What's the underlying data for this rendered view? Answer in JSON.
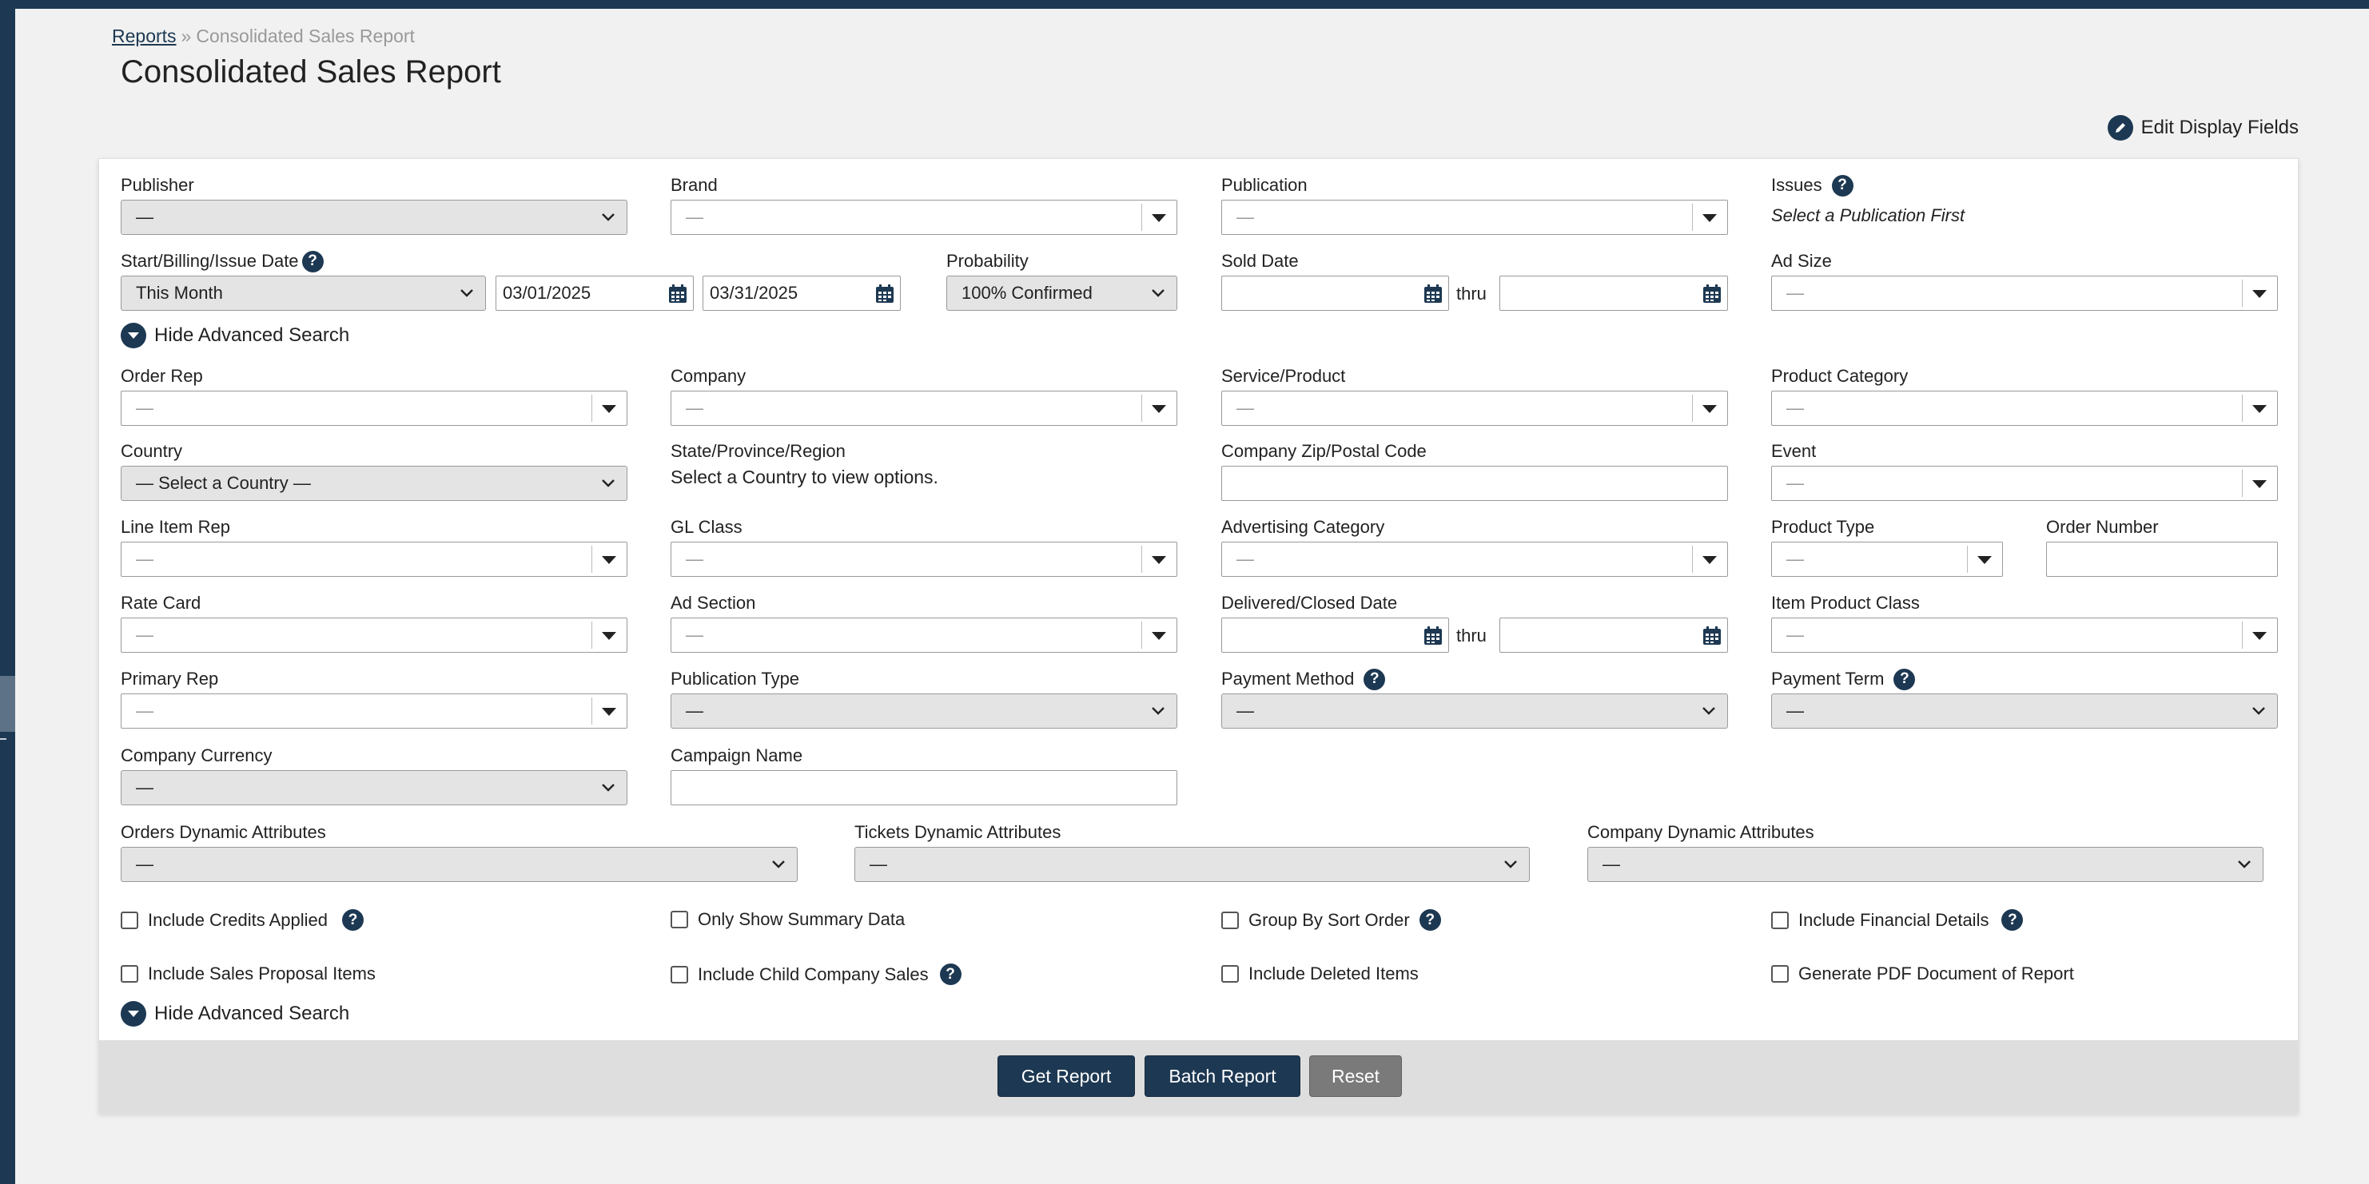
{
  "breadcrumb": {
    "parent": "Reports",
    "separator": "»",
    "current": "Consolidated Sales Report"
  },
  "page_title": "Consolidated Sales Report",
  "edit_display_fields": "Edit Display Fields",
  "placeholder": "—",
  "publisher": {
    "label": "Publisher",
    "value": "—"
  },
  "brand": {
    "label": "Brand",
    "value": "—"
  },
  "publication": {
    "label": "Publication",
    "value": "—"
  },
  "issues": {
    "label": "Issues",
    "note": "Select a Publication First"
  },
  "date_range": {
    "label": "Start/Billing/Issue Date",
    "preset": "This Month",
    "start": "03/01/2025",
    "end": "03/31/2025"
  },
  "probability": {
    "label": "Probability",
    "value": "100% Confirmed"
  },
  "sold_date": {
    "label": "Sold Date",
    "from": "",
    "thru": "thru",
    "to": ""
  },
  "ad_size": {
    "label": "Ad Size",
    "value": "—"
  },
  "advanced_toggle": "Hide Advanced Search",
  "order_rep": {
    "label": "Order Rep",
    "value": "—"
  },
  "company": {
    "label": "Company",
    "value": "—"
  },
  "service_product": {
    "label": "Service/Product",
    "value": "—"
  },
  "product_category": {
    "label": "Product Category",
    "value": "—"
  },
  "country": {
    "label": "Country",
    "value": "— Select a Country —"
  },
  "state": {
    "label": "State/Province/Region",
    "note": "Select a Country to view options."
  },
  "zip": {
    "label": "Company Zip/Postal Code",
    "value": ""
  },
  "event": {
    "label": "Event",
    "value": "—"
  },
  "line_item_rep": {
    "label": "Line Item Rep",
    "value": "—"
  },
  "gl_class": {
    "label": "GL Class",
    "value": "—"
  },
  "advertising_category": {
    "label": "Advertising Category",
    "value": "—"
  },
  "product_type": {
    "label": "Product Type",
    "value": "—"
  },
  "order_number": {
    "label": "Order Number",
    "value": ""
  },
  "rate_card": {
    "label": "Rate Card",
    "value": "—"
  },
  "ad_section": {
    "label": "Ad Section",
    "value": "—"
  },
  "delivered_date": {
    "label": "Delivered/Closed Date",
    "from": "",
    "thru": "thru",
    "to": ""
  },
  "item_product_class": {
    "label": "Item Product Class",
    "value": "—"
  },
  "primary_rep": {
    "label": "Primary Rep",
    "value": "—"
  },
  "publication_type": {
    "label": "Publication Type",
    "value": "—"
  },
  "payment_method": {
    "label": "Payment Method",
    "value": "—"
  },
  "payment_term": {
    "label": "Payment Term",
    "value": "—"
  },
  "company_currency": {
    "label": "Company Currency",
    "value": "—"
  },
  "campaign_name": {
    "label": "Campaign Name",
    "value": ""
  },
  "orders_dyn": {
    "label": "Orders Dynamic Attributes",
    "value": "—"
  },
  "tickets_dyn": {
    "label": "Tickets Dynamic Attributes",
    "value": "—"
  },
  "company_dyn": {
    "label": "Company Dynamic Attributes",
    "value": "—"
  },
  "checkboxes": {
    "credits_applied": "Include Credits Applied",
    "summary_only": "Only Show Summary Data",
    "group_sort": "Group By Sort Order",
    "financial_details": "Include Financial Details",
    "proposal_items": "Include Sales Proposal Items",
    "child_company": "Include Child Company Sales",
    "deleted_items": "Include Deleted Items",
    "generate_pdf": "Generate PDF Document of Report"
  },
  "buttons": {
    "get_report": "Get Report",
    "batch_report": "Batch Report",
    "reset": "Reset"
  },
  "colors": {
    "brand": "#1d3852",
    "background": "#f1f1f1",
    "reset": "#7a7a7a"
  }
}
